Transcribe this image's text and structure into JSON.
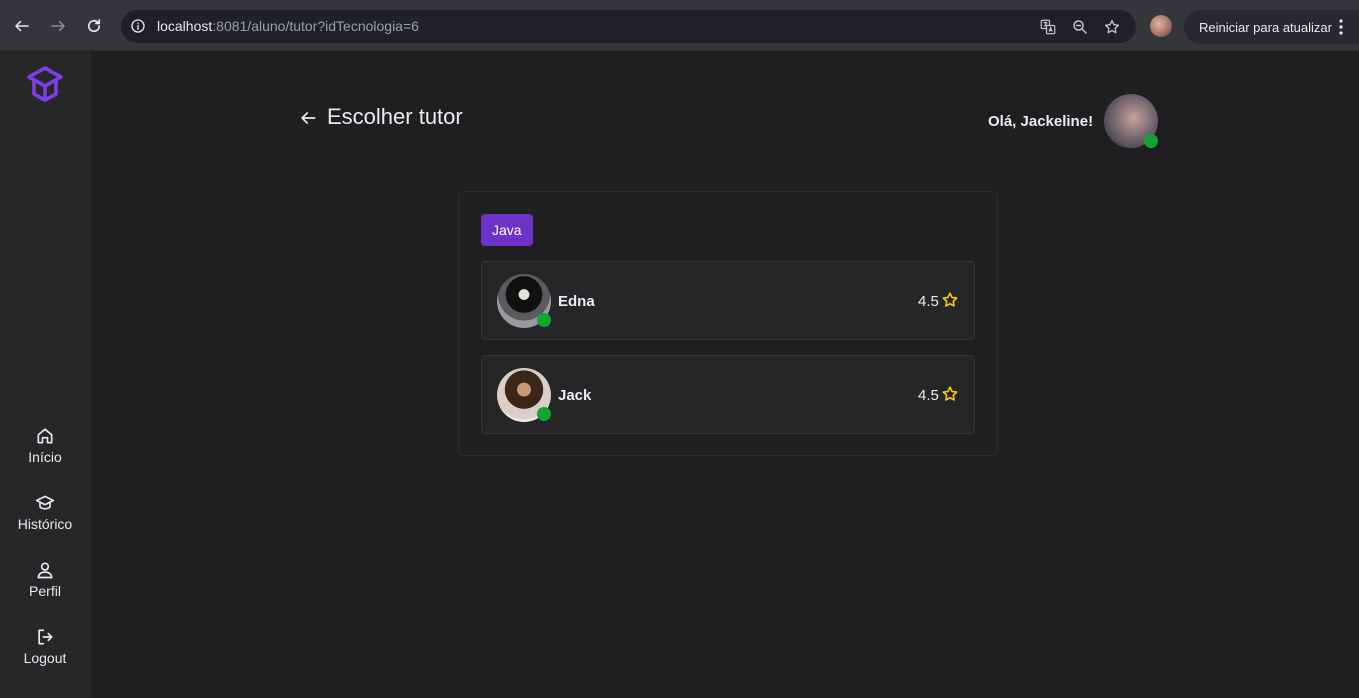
{
  "browser": {
    "url_host": "localhost",
    "url_rest": ":8081/aluno/tutor?idTecnologia=6",
    "update_label": "Reiniciar para atualizar",
    "icons": [
      "back-icon",
      "forward-icon",
      "reload-icon",
      "info-icon",
      "translate-icon",
      "zoom-out-icon",
      "bookmark-star-icon",
      "profile-avatar",
      "menu-kebab-icon"
    ]
  },
  "sidebar": {
    "logo": "graduation-box-logo",
    "items": [
      {
        "label": "Início",
        "icon": "home-icon"
      },
      {
        "label": "Histórico",
        "icon": "graduation-cap-icon"
      },
      {
        "label": "Perfil",
        "icon": "user-icon"
      },
      {
        "label": "Logout",
        "icon": "logout-icon"
      }
    ]
  },
  "header": {
    "title": "Escolher tutor",
    "greeting": "Olá, Jackeline!"
  },
  "technology": {
    "tag": "Java"
  },
  "tutors": [
    {
      "name": "Edna",
      "rating": "4.5",
      "online": true
    },
    {
      "name": "Jack",
      "rating": "4.5",
      "online": true
    }
  ],
  "colors": {
    "accent": "#6d32c8",
    "online": "#13a531",
    "star": "#f5c518",
    "background": "#1f1f21",
    "sidebar": "#27272a"
  }
}
